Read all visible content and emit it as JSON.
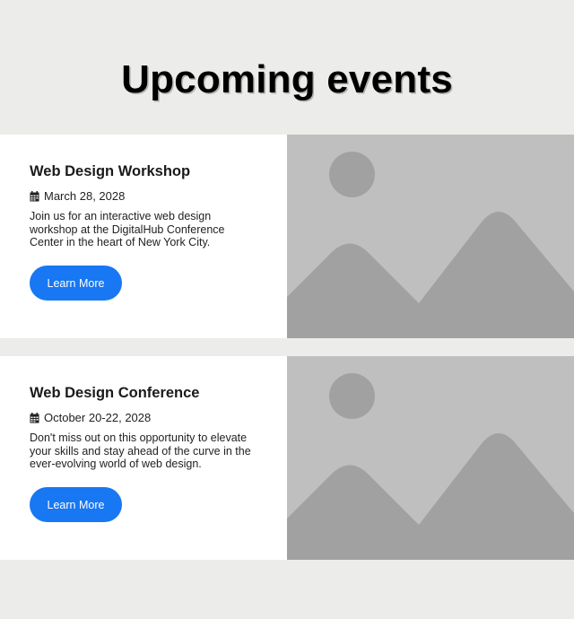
{
  "page": {
    "title": "Upcoming events"
  },
  "events": [
    {
      "title": "Web Design Workshop",
      "date": "March 28, 2028",
      "description": "Join us for an interactive web design workshop at the DigitalHub Conference Center in the heart of New York City.",
      "button_label": "Learn More",
      "date_icon": "calendar-icon",
      "image_icon": "image-placeholder"
    },
    {
      "title": "Web Design Conference",
      "date": "October 20-22, 2028",
      "description": "Don't miss out on this opportunity to elevate your skills and stay ahead of the curve in the ever-evolving world of web design.",
      "button_label": "Learn More",
      "date_icon": "calendar-icon",
      "image_icon": "image-placeholder"
    }
  ],
  "colors": {
    "background": "#ecedea",
    "card": "#ffffff",
    "button": "#1877f2",
    "placeholder_bg": "#bfbfbf",
    "placeholder_shape": "#a1a1a1"
  }
}
